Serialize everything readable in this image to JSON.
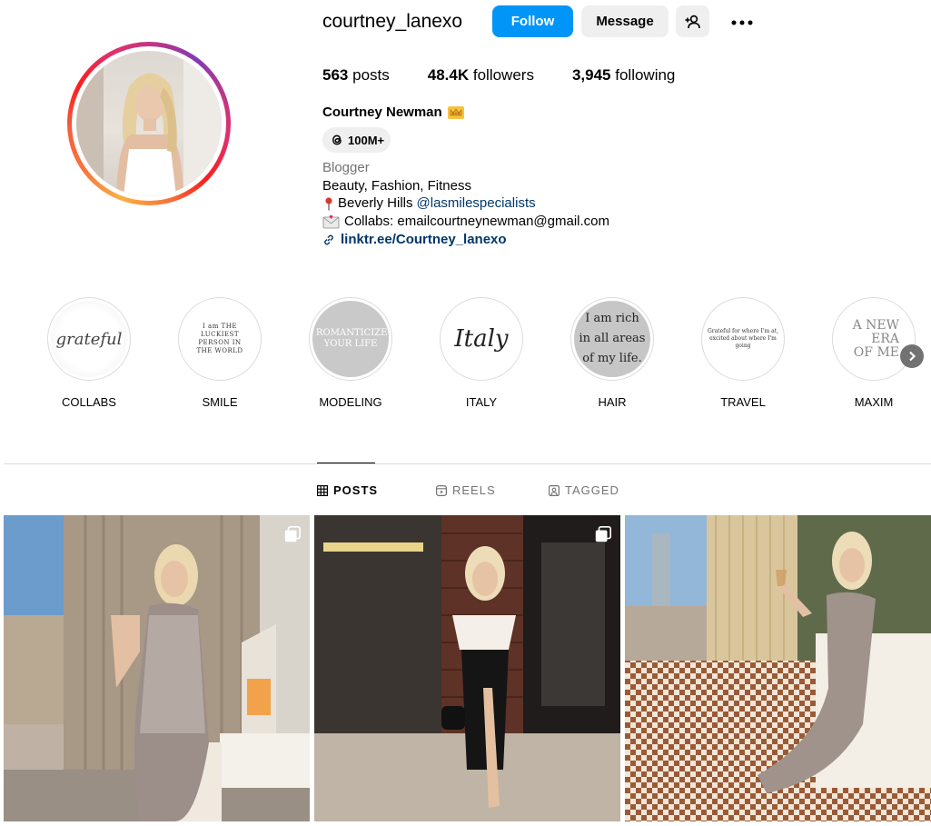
{
  "profile": {
    "username": "courtney_lanexo",
    "full_name": "Courtney Newman",
    "threads_count": "100M+",
    "category": "Blogger",
    "bio_line1": "Beauty, Fashion, Fitness",
    "bio_line2_text": "Beverly Hills",
    "bio_line2_mention": "@lasmilespecialists",
    "bio_line3": "Collabs: emailcourtneynewman@gmail.com",
    "link": "linktr.ee/Courtney_lanexo"
  },
  "actions": {
    "follow": "Follow",
    "message": "Message"
  },
  "stats": {
    "posts_count": "563",
    "posts_label": "posts",
    "followers_count": "48.4K",
    "followers_label": "followers",
    "following_count": "3,945",
    "following_label": "following"
  },
  "highlights": [
    {
      "label": "COLLABS",
      "cover_text": "grateful"
    },
    {
      "label": "SMILE",
      "cover_text": "I am THE LUCKIEST PERSON IN THE WORLD"
    },
    {
      "label": "MODELING",
      "cover_text": "ROMANTICIZE YOUR LIFE"
    },
    {
      "label": "ITALY",
      "cover_text": "Italy"
    },
    {
      "label": "HAIR",
      "cover_text": "I am rich in all areas of my life."
    },
    {
      "label": "TRAVEL",
      "cover_text": "Grateful for where I'm at, excited about where I'm going"
    },
    {
      "label": "MAXIM",
      "cover_text": "A NEW ERA OF ME"
    }
  ],
  "tabs": [
    {
      "label": "POSTS",
      "icon": "grid-icon",
      "active": true
    },
    {
      "label": "REELS",
      "icon": "reels-icon",
      "active": false
    },
    {
      "label": "TAGGED",
      "icon": "tagged-icon",
      "active": false
    }
  ],
  "colors": {
    "follow_button": "#0095f6",
    "secondary_button": "#efefef",
    "link": "#00376b",
    "muted": "#737373"
  }
}
